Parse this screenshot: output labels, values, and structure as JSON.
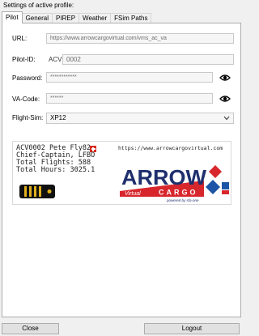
{
  "heading": "Settings of active profile:",
  "tabs": [
    {
      "label": "Pilot",
      "active": true
    },
    {
      "label": "General",
      "active": false
    },
    {
      "label": "PIREP",
      "active": false
    },
    {
      "label": "Weather",
      "active": false
    },
    {
      "label": "FSim Paths",
      "active": false
    }
  ],
  "form": {
    "url_label": "URL:",
    "url_value": "https://www.arrowcargovirtual.com/vms_ac_va",
    "pilot_id_label": "Pilot-ID:",
    "pilot_id_prefix": "ACV",
    "pilot_id_value": "0002",
    "password_label": "Password:",
    "password_value": "************",
    "va_code_label": "VA-Code:",
    "va_code_value": "******",
    "flight_sim_label": "Flight-Sim:",
    "flight_sim_value": "XP12"
  },
  "banner": {
    "line1": "ACV0002 Pete Fly82",
    "line2": "Chief-Captain, LFBO",
    "line3": "Total Flights: 588",
    "line4": "Total Hours: 3025.1",
    "url": "https://www.arrowcargovirtual.com",
    "logo_text": "ARROW",
    "logo_sub": "CARGO",
    "logo_side": "Virtual",
    "logo_powered": "powered by sfa-one"
  },
  "buttons": {
    "close_label": "Close",
    "logout_label": "Logout"
  },
  "colors": {
    "logo_navy": "#1f2f6e",
    "logo_red": "#d8262d",
    "logo_blue": "#1c55a6",
    "flag_red": "#d52b1e",
    "epaulette_gold": "#e0b01e"
  },
  "icons": {
    "password_toggle": "eye-icon",
    "va_code_toggle": "eye-icon",
    "dropdown": "chevron-down-icon",
    "flag": "swiss-flag-icon",
    "rank": "epaulette-icon"
  }
}
